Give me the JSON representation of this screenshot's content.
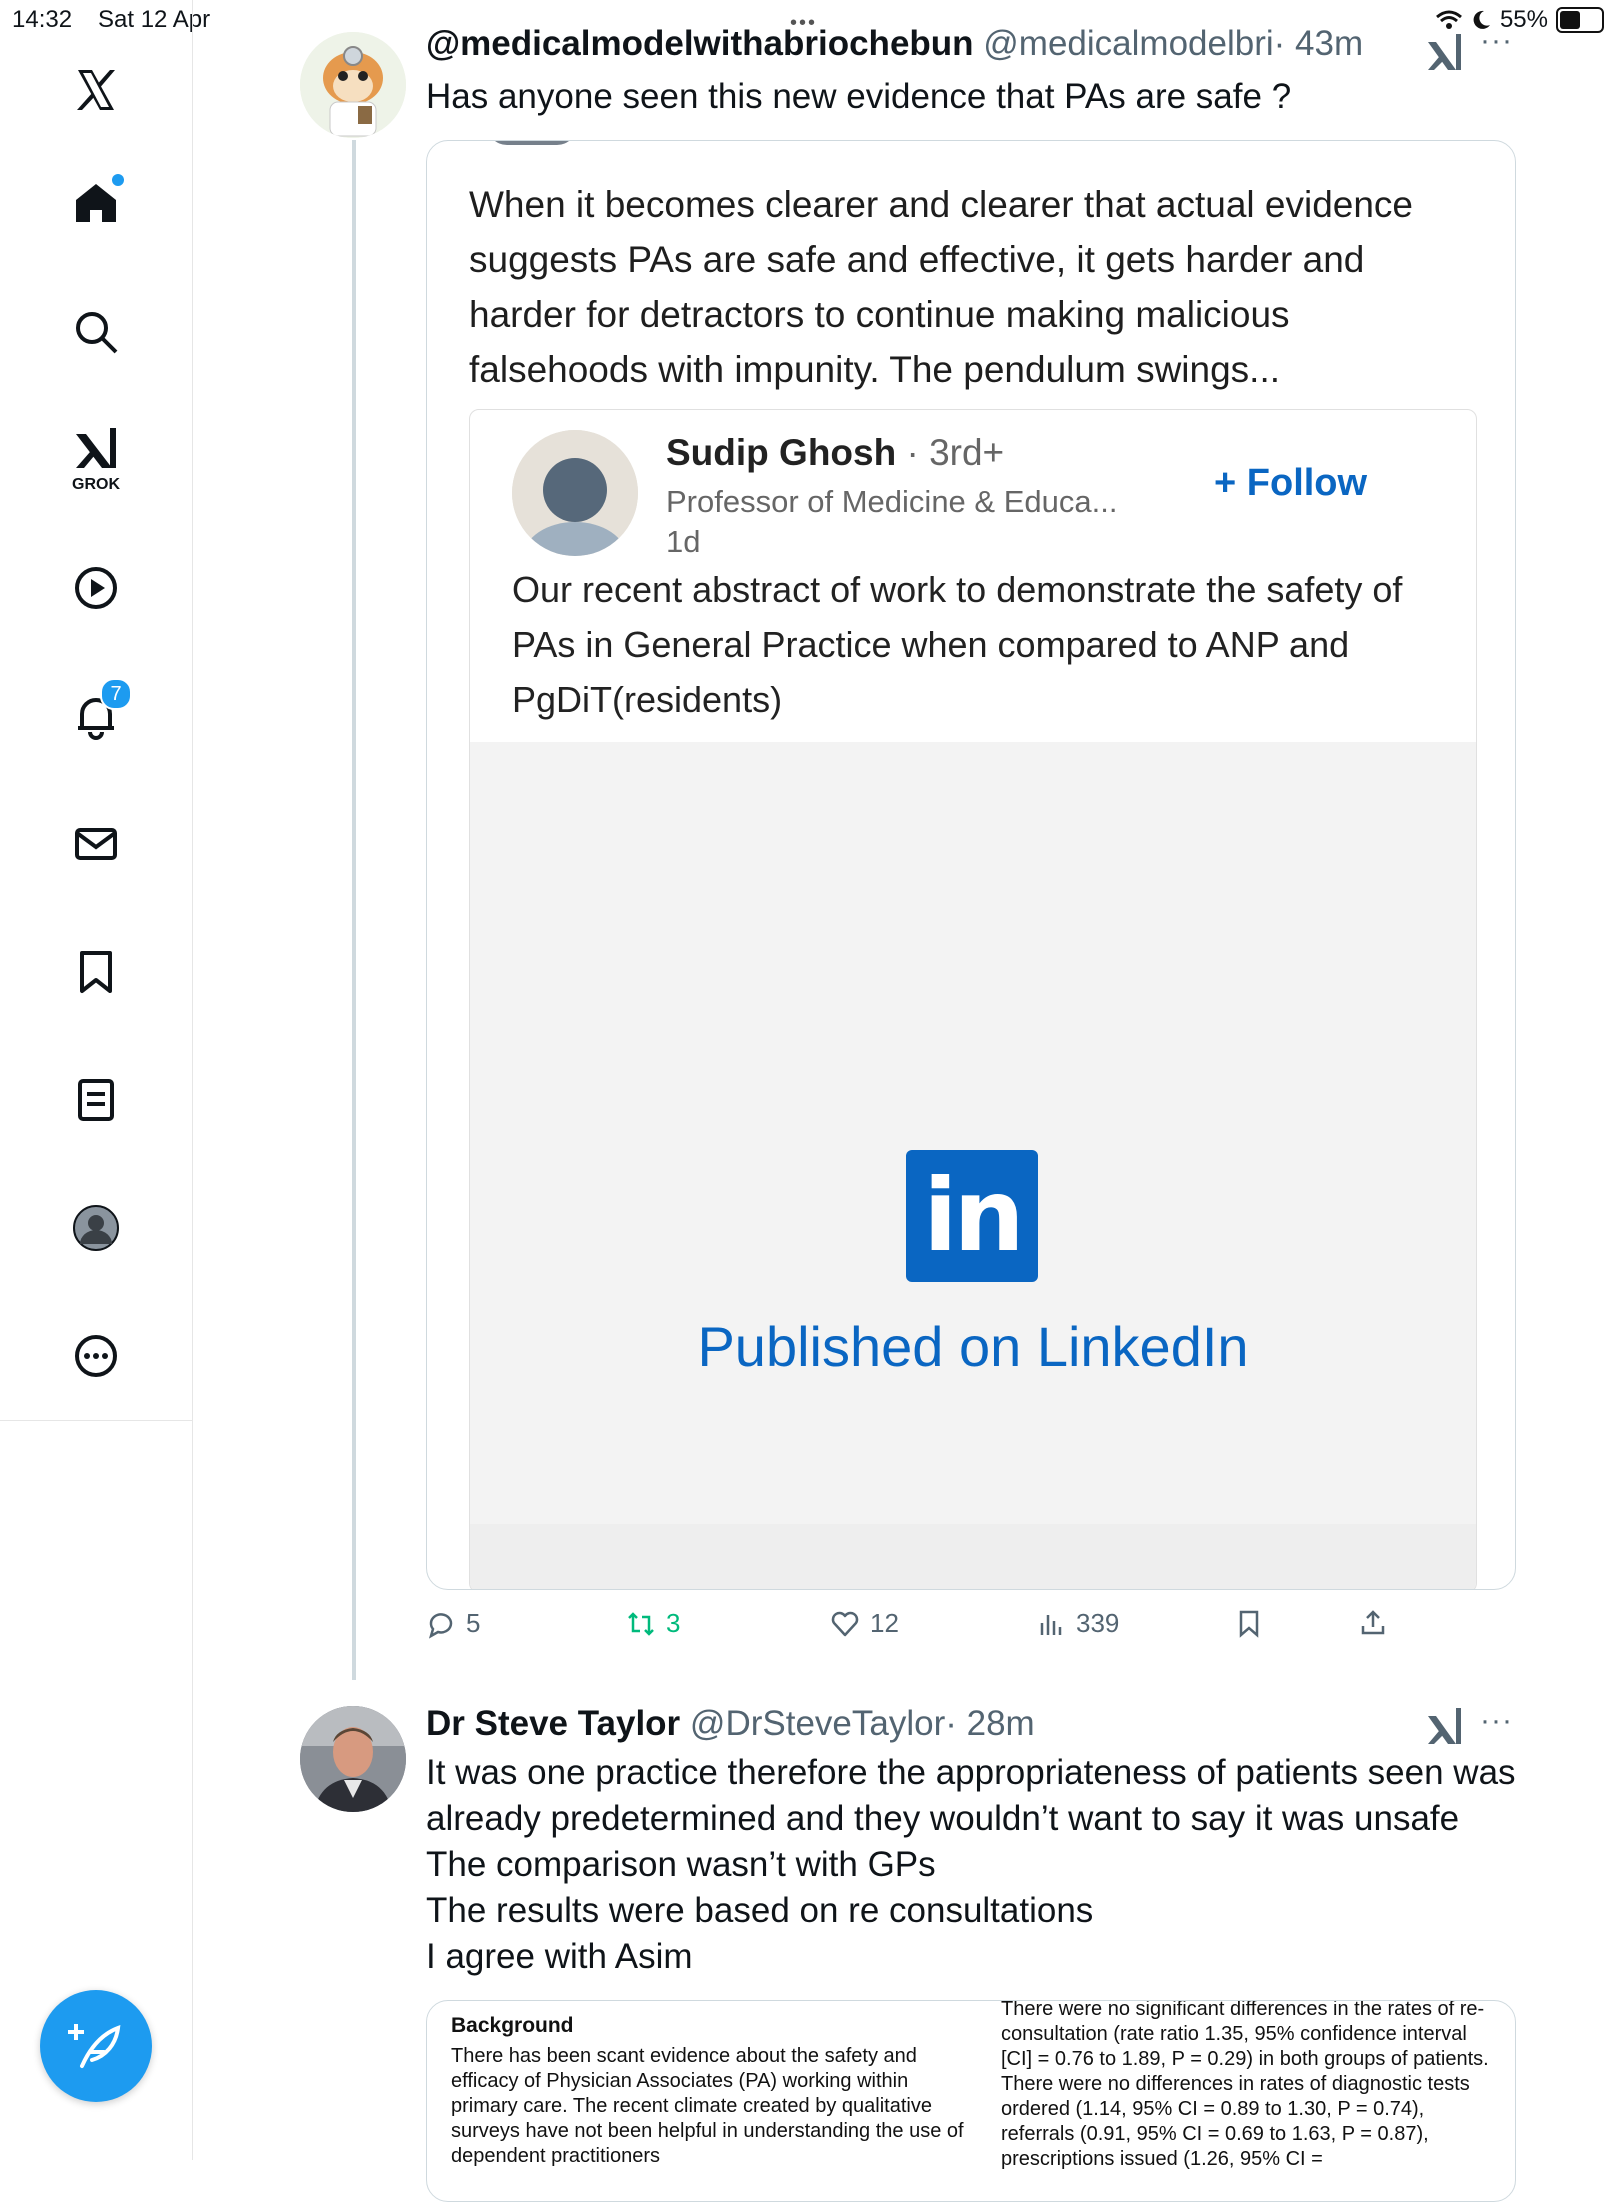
{
  "status_bar": {
    "time": "14:32",
    "date": "Sat 12 Apr",
    "battery": "55%",
    "battery_level": 0.55
  },
  "sidebar": {
    "grok_label": "GROK",
    "notifications_count": "7"
  },
  "tweet1": {
    "name": "@medicalmodelwithabriochebun",
    "handle": "@medicalmodelbri",
    "time": "· 43m",
    "text": "Has anyone seen this new evidence that PAs are safe ?",
    "quote": {
      "text": "When it becomes clearer and clearer that actual evidence suggests PAs are safe and effective, it gets harder and harder for detractors to continue making malicious falsehoods with impunity. The pendulum swings...",
      "linkedin": {
        "author": "Sudip Ghosh",
        "degree": "· 3rd+",
        "headline": "Professor of Medicine & Educa...",
        "time": "1d",
        "follow": "Follow",
        "body": "Our recent abstract of work to demonstrate the safety of PAs in General Practice when compared to ANP and PgDiT(residents)",
        "logo": "in",
        "published": "Published on LinkedIn"
      }
    },
    "actions": {
      "replies": "5",
      "reposts": "3",
      "likes": "12",
      "views": "339"
    }
  },
  "tweet2": {
    "name": "Dr Steve Taylor",
    "handle": "@DrSteveTaylor",
    "time": "· 28m",
    "lines": [
      "It was one practice therefore the appropriateness of patients seen was",
      "already predetermined and they wouldn’t want to say it was unsafe",
      "The comparison wasn’t with GPs",
      "The results were based on re consultations",
      "I agree with Asim"
    ],
    "abstract": {
      "heading": "Background",
      "left": "There has been scant evidence about the safety and efficacy of Physician Associates (PA) working within primary care. The recent climate created by qualitative surveys have not been helpful in understanding the use of dependent practitioners",
      "right": "There were no significant differences in the rates of re-consultation (rate ratio 1.35, 95% confidence interval [CI] = 0.76 to 1.89, P = 0.29) in both groups of patients. There were no differences in rates of diagnostic tests ordered (1.14, 95% CI = 0.89 to 1.30, P = 0.74), referrals (0.91, 95% CI = 0.69 to 1.63, P = 0.87), prescriptions issued (1.26, 95% CI ="
    }
  }
}
